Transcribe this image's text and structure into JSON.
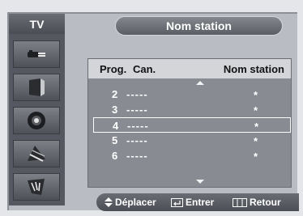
{
  "header": {
    "tv_label": "TV",
    "title": "Nom station"
  },
  "sidebar": {
    "items": [
      {
        "icon": "antenna-plug-icon"
      },
      {
        "icon": "picture-icon"
      },
      {
        "icon": "speaker-icon"
      },
      {
        "icon": "channel-icon"
      },
      {
        "icon": "setup-icon"
      }
    ]
  },
  "table": {
    "col_prog": "Prog.",
    "col_can": "Can.",
    "col_name": "Nom station",
    "rows": [
      {
        "prog": "2",
        "can": "-----",
        "name": "*"
      },
      {
        "prog": "3",
        "can": "-----",
        "name": "*"
      },
      {
        "prog": "4",
        "can": "-----",
        "name": "*",
        "selected": true
      },
      {
        "prog": "5",
        "can": "-----",
        "name": "*"
      },
      {
        "prog": "6",
        "can": "-----",
        "name": "*"
      }
    ]
  },
  "footer": {
    "move_label": "Déplacer",
    "enter_label": "Entrer",
    "return_label": "Retour"
  }
}
